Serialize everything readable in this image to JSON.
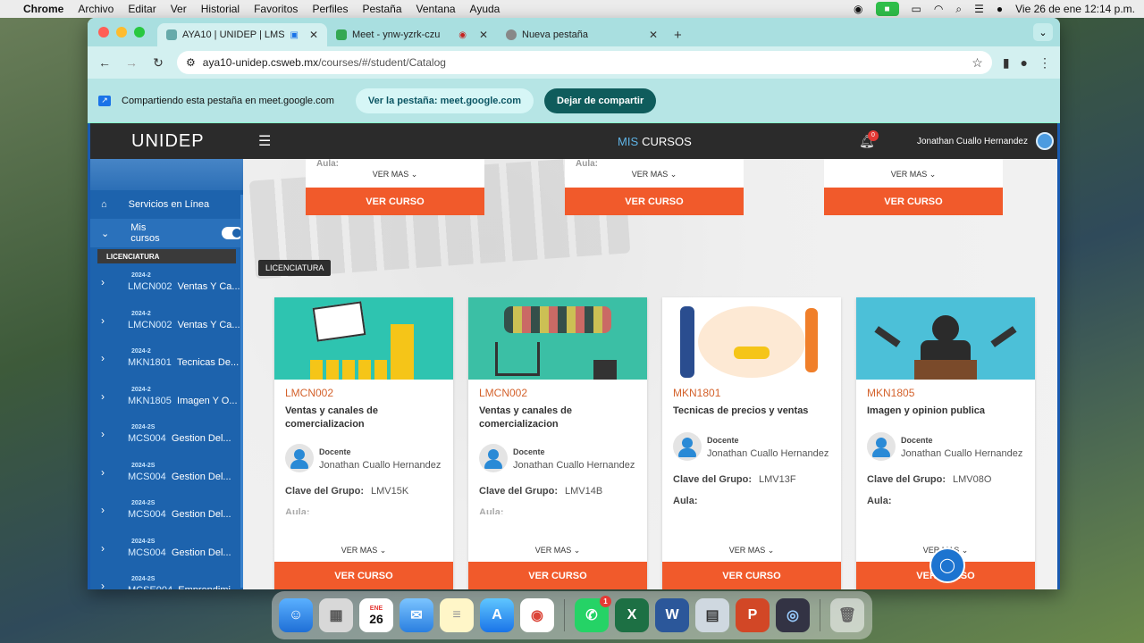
{
  "menubar": {
    "app": "Chrome",
    "items": [
      "Archivo",
      "Editar",
      "Ver",
      "Historial",
      "Favoritos",
      "Perfiles",
      "Pestaña",
      "Ventana",
      "Ayuda"
    ],
    "datetime": "Vie 26 de ene  12:14 p.m."
  },
  "tabs": [
    {
      "label": "AYA10 | UNIDEP | LMS",
      "active": true
    },
    {
      "label": "Meet - ynw-yzrk-czu",
      "active": false
    },
    {
      "label": "Nueva pestaña",
      "active": false
    }
  ],
  "address": {
    "host": "aya10-unidep.csweb.mx",
    "path": "/courses/#/student/Catalog"
  },
  "sharebar": {
    "text": "Compartiendo esta pestaña en meet.google.com",
    "view_button": "Ver la pestaña: meet.google.com",
    "stop_button": "Dejar de compartir"
  },
  "topnav": {
    "logo": "UNIDEP",
    "title_a": "MIS",
    "title_b": "CURSOS",
    "notification_count": "0",
    "user_name": "Jonathan Cuallo Hernandez"
  },
  "sidebar": {
    "servicios": "Servicios en Línea",
    "mis_cursos": "Mis cursos",
    "section": "LICENCIATURA",
    "courses": [
      {
        "sem": "2024-2",
        "code": "LMCN002",
        "name": "Ventas Y Ca..."
      },
      {
        "sem": "2024-2",
        "code": "LMCN002",
        "name": "Ventas Y Ca..."
      },
      {
        "sem": "2024-2",
        "code": "MKN1801",
        "name": "Tecnicas De..."
      },
      {
        "sem": "2024-2",
        "code": "MKN1805",
        "name": "Imagen Y O..."
      },
      {
        "sem": "2024-2S",
        "code": "MCS004",
        "name": "Gestion Del..."
      },
      {
        "sem": "2024-2S",
        "code": "MCS004",
        "name": "Gestion Del..."
      },
      {
        "sem": "2024-2S",
        "code": "MCS004",
        "name": "Gestion Del..."
      },
      {
        "sem": "2024-2S",
        "code": "MCS004",
        "name": "Gestion Del..."
      },
      {
        "sem": "2024-2S",
        "code": "MCSE004",
        "name": "Emprendimi..."
      }
    ]
  },
  "top_cards": [
    {
      "aula": "Aula:",
      "vermas": "VER MAS",
      "button": "VER CURSO"
    },
    {
      "aula": "Aula:",
      "vermas": "VER MAS",
      "button": "VER CURSO"
    },
    {
      "aula": "",
      "vermas": "VER MAS",
      "button": "VER CURSO"
    }
  ],
  "section_tag": "LICENCIATURA",
  "cards": [
    {
      "code": "LMCN002",
      "title": "Ventas y canales de comercializacion",
      "docente_label": "Docente",
      "docente": "Jonathan Cuallo Hernandez",
      "clave_label": "Clave del Grupo:",
      "clave": "LMV15K",
      "aula": "Aula:",
      "vermas": "VER MAS",
      "button": "VER CURSO"
    },
    {
      "code": "LMCN002",
      "title": "Ventas y canales de comercializacion",
      "docente_label": "Docente",
      "docente": "Jonathan Cuallo Hernandez",
      "clave_label": "Clave del Grupo:",
      "clave": "LMV14B",
      "aula": "Aula:",
      "vermas": "VER MAS",
      "button": "VER CURSO"
    },
    {
      "code": "MKN1801",
      "title": "Tecnicas de precios y ventas",
      "docente_label": "Docente",
      "docente": "Jonathan Cuallo Hernandez",
      "clave_label": "Clave del Grupo:",
      "clave": "LMV13F",
      "aula": "Aula:",
      "vermas": "VER MAS",
      "button": "VER CURSO"
    },
    {
      "code": "MKN1805",
      "title": "Imagen y opinion publica",
      "docente_label": "Docente",
      "docente": "Jonathan Cuallo Hernandez",
      "clave_label": "Clave del Grupo:",
      "clave": "LMV08O",
      "aula": "Aula:",
      "vermas": "VER MAS",
      "button": "VER CURSO"
    }
  ],
  "dock": {
    "calendar_month": "ENE",
    "calendar_day": "26",
    "whatsapp_badge": "1"
  }
}
